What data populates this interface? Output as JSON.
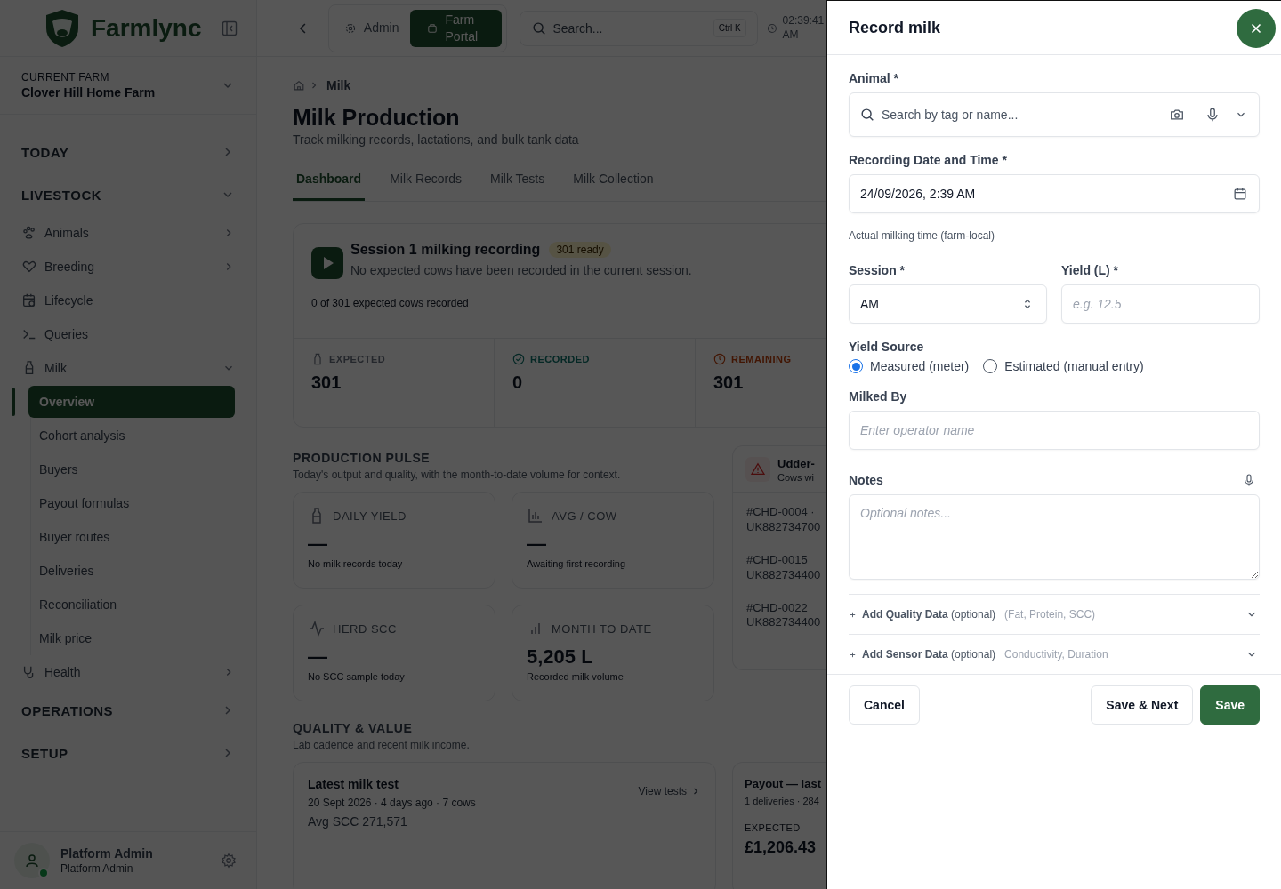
{
  "sidebar": {
    "brand": "Farmlync",
    "farm_label": "CURRENT FARM",
    "farm_name": "Clover Hill Home Farm",
    "sections": [
      {
        "label": "TODAY",
        "expanded": false
      },
      {
        "label": "LIVESTOCK",
        "expanded": true,
        "items": [
          {
            "label": "Animals",
            "expanded": false
          },
          {
            "label": "Breeding",
            "expanded": false
          },
          {
            "label": "Lifecycle"
          },
          {
            "label": "Queries"
          },
          {
            "label": "Milk",
            "expanded": true,
            "children": [
              {
                "label": "Overview",
                "selected": true
              },
              {
                "label": "Cohort analysis",
                "selected": false
              },
              {
                "label": "Buyers",
                "selected": false
              },
              {
                "label": "Payout formulas",
                "selected": false
              },
              {
                "label": "Buyer routes",
                "selected": false
              },
              {
                "label": "Deliveries",
                "selected": false
              },
              {
                "label": "Reconciliation",
                "selected": false
              },
              {
                "label": "Milk price",
                "selected": false
              }
            ]
          },
          {
            "label": "Health",
            "expanded": false
          }
        ]
      },
      {
        "label": "OPERATIONS",
        "expanded": false
      },
      {
        "label": "SETUP",
        "expanded": false
      }
    ],
    "user": {
      "name": "Platform Admin",
      "role": "Platform Admin"
    }
  },
  "topbar": {
    "portals": [
      {
        "label": "Admin",
        "selected": false
      },
      {
        "label": "Farm Portal",
        "selected": true
      }
    ],
    "search": {
      "placeholder": "Search...",
      "shortcut": "Ctrl K"
    },
    "time": "02:39:41 AM"
  },
  "page": {
    "breadcrumb": "Milk",
    "title": "Milk Production",
    "subtitle": "Track milking records, lactations, and bulk tank data",
    "tabs": [
      {
        "label": "Dashboard",
        "selected": true
      },
      {
        "label": "Milk Records",
        "selected": false
      },
      {
        "label": "Milk Tests",
        "selected": false
      },
      {
        "label": "Milk Collection",
        "selected": false
      }
    ],
    "session": {
      "title": "Session 1 milking recording",
      "badge": "301 ready",
      "description": "No expected cows have been recorded in the current session.",
      "progress": "0 of 301 expected cows recorded",
      "stats": [
        {
          "kind": "expected",
          "label": "EXPECTED",
          "value": "301"
        },
        {
          "kind": "recorded",
          "label": "RECORDED",
          "value": "0"
        },
        {
          "kind": "remaining",
          "label": "REMAINING",
          "value": "301"
        }
      ]
    },
    "pulse": {
      "title": "PRODUCTION PULSE",
      "subtitle": "Today's output and quality, with the month-to-date volume for context.",
      "metrics": [
        {
          "label": "DAILY YIELD",
          "value": "—",
          "note": "No milk records today"
        },
        {
          "label": "AVG / COW",
          "value": "—",
          "note": "Awaiting first recording"
        },
        {
          "label": "HERD SCC",
          "value": "—",
          "note": "No SCC sample today"
        },
        {
          "label": "MONTH TO DATE",
          "value": "5,205 L",
          "note": "Recorded milk volume"
        }
      ],
      "alert": {
        "title": "Udder-",
        "subtitle": "Cows wi",
        "rows": [
          {
            "tag": "#CHD-0004 ·",
            "id": "UK882734700"
          },
          {
            "tag": "#CHD-0015",
            "id": "UK882734400"
          },
          {
            "tag": "#CHD-0022",
            "id": "UK882734400"
          }
        ]
      }
    },
    "quality": {
      "title": "QUALITY & VALUE",
      "subtitle": "Lab cadence and recent milk income.",
      "test": {
        "title": "Latest milk test",
        "meta": "20 Sept 2026 · 4 days ago · 7 cows",
        "value": "Avg SCC 271,571",
        "link": "View tests"
      },
      "payout": {
        "title": "Payout — last",
        "meta": "1 deliveries · 284",
        "label": "EXPECTED",
        "value": "£1,206.43"
      }
    }
  },
  "drawer": {
    "title": "Record milk",
    "animal": {
      "label": "Animal *",
      "placeholder": "Search by tag or name..."
    },
    "datetime": {
      "label": "Recording Date and Time *",
      "value": "24/09/2026, 2:39 AM",
      "hint": "Actual milking time (farm-local)"
    },
    "session": {
      "label": "Session *",
      "value": "AM"
    },
    "yield": {
      "label": "Yield (L) *",
      "placeholder": "e.g. 12.5"
    },
    "yield_source": {
      "label": "Yield Source",
      "options": [
        {
          "label": "Measured (meter)",
          "selected": true
        },
        {
          "label": "Estimated (manual entry)",
          "selected": false
        }
      ]
    },
    "milked_by": {
      "label": "Milked By",
      "placeholder": "Enter operator name"
    },
    "notes": {
      "label": "Notes",
      "placeholder": "Optional notes..."
    },
    "sections": [
      {
        "title": "**Add Quality Data** (optional)",
        "hint": "(Fat, Protein, SCC)",
        "expanded": false
      },
      {
        "title": "**Add Sensor Data** (optional)",
        "hint": "Conductivity, Duration",
        "expanded": false
      }
    ],
    "buttons": [
      {
        "label": "Cancel",
        "kind": "secondary"
      },
      {
        "label": "Save & Next",
        "kind": "secondary"
      },
      {
        "label": "Save",
        "kind": "primary"
      }
    ]
  }
}
